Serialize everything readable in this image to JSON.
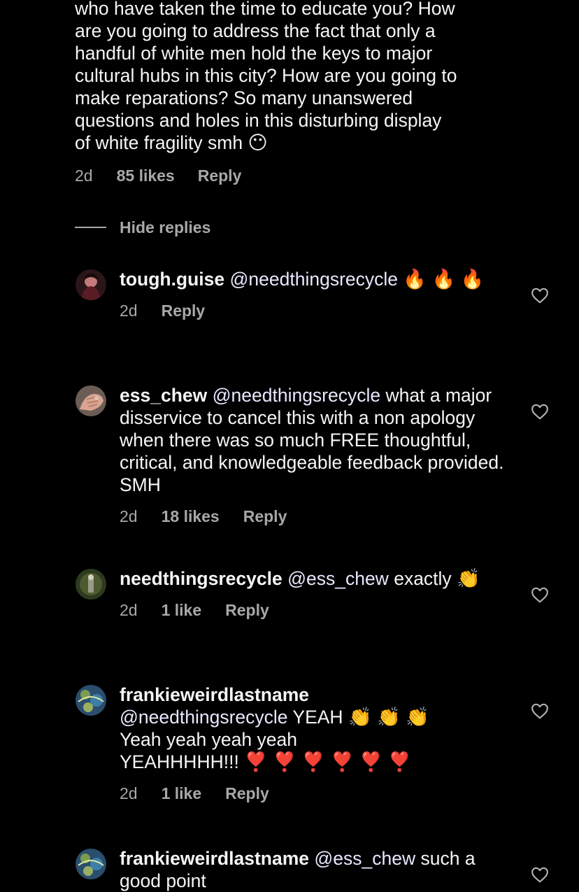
{
  "top_comment": {
    "lines": [
      "who have taken the time to educate you? How",
      "are you going to address the fact that only a",
      "handful of white men hold the keys to major",
      "cultural hubs in this city? How are you going to",
      "make reparations? So many unanswered",
      "questions and holes in this disturbing display",
      "of white fragility smh"
    ],
    "emoji": "😶",
    "time": "2d",
    "likes": "85 likes",
    "reply_label": "Reply"
  },
  "hide_replies": "Hide replies",
  "replies": [
    {
      "username": "tough.guise",
      "mention": "@needthingsrecycle",
      "text_after": "",
      "emoji": "🔥 🔥 🔥",
      "time": "2d",
      "likes": "",
      "reply_label": "Reply"
    },
    {
      "username": "ess_chew",
      "mention": "@needthingsrecycle",
      "text_after": "what a major disservice to cancel this with a non apology when there was so much FREE thoughtful, critical, and knowledgeable feedback provided. SMH",
      "time": "2d",
      "likes": "18 likes",
      "reply_label": "Reply"
    },
    {
      "username": "needthingsrecycle",
      "mention": "@ess_chew",
      "text_after": "exactly",
      "emoji": "👏",
      "time": "2d",
      "likes": "1 like",
      "reply_label": "Reply"
    },
    {
      "username": "frankieweirdlastname",
      "mention": "@needthingsrecycle",
      "text_after": "YEAH",
      "emoji": "👏 👏 👏",
      "line2": "Yeah yeah yeah yeah",
      "line3": "YEAHHHHH!!!",
      "emoji2": "❣️ ❣️ ❣️ ❣️ ❣️ ❣️",
      "time": "2d",
      "likes": "1 like",
      "reply_label": "Reply"
    },
    {
      "username": "frankieweirdlastname",
      "mention": "@ess_chew",
      "text_after": "such a good point",
      "time": "",
      "likes": "",
      "reply_label": ""
    }
  ],
  "icons": {
    "like": "heart-outline-icon"
  },
  "colors": {
    "background": "#000000",
    "text": "#f5f5f5",
    "secondary": "#a8a8a8",
    "mention": "#e8e8ff"
  }
}
